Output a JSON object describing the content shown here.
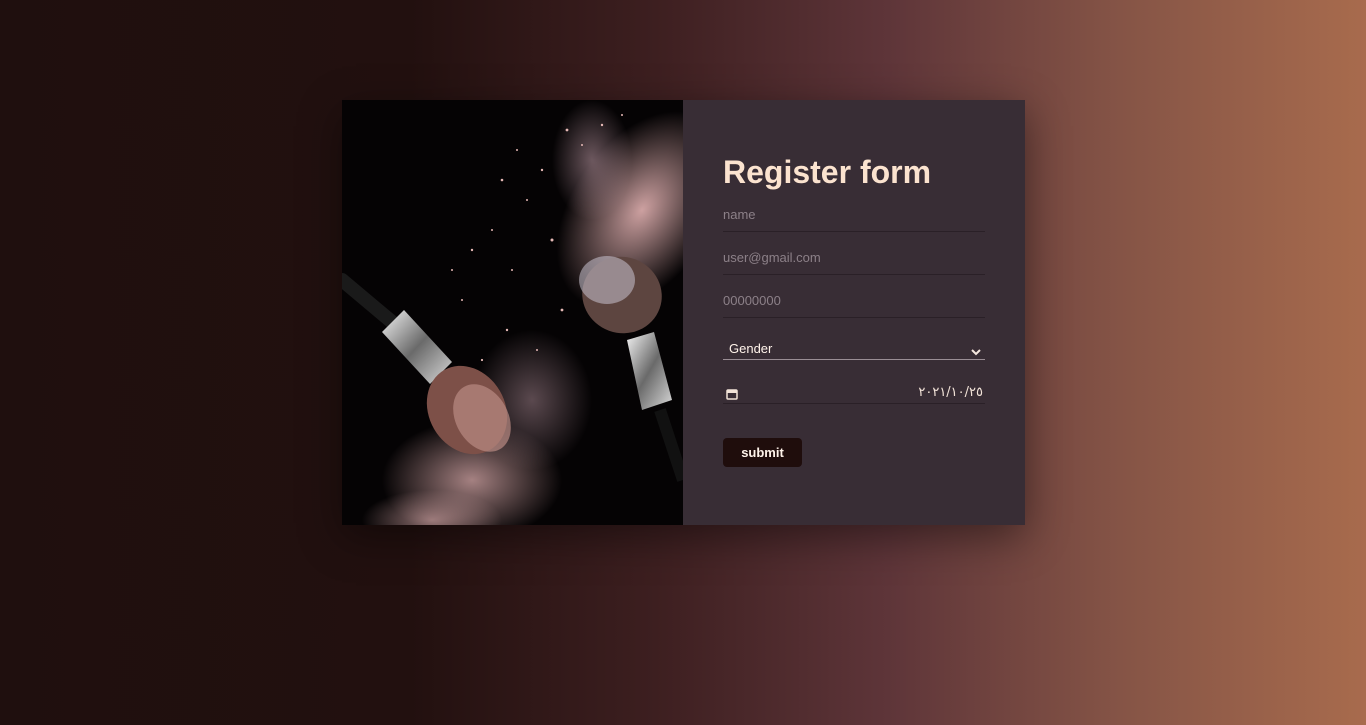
{
  "form": {
    "title": "Register form",
    "name_placeholder": "name",
    "email_placeholder": "user@gmail.com",
    "phone_placeholder": "00000000",
    "gender_selected": "Gender",
    "date_value": "٢٠٢١/١٠/٢٥",
    "submit_label": "submit"
  },
  "colors": {
    "title": "#fbe3cf",
    "panel": "#382d35",
    "button": "#1f0d0c"
  },
  "icons": {
    "select": "chevron-down-icon",
    "date": "calendar-icon"
  }
}
